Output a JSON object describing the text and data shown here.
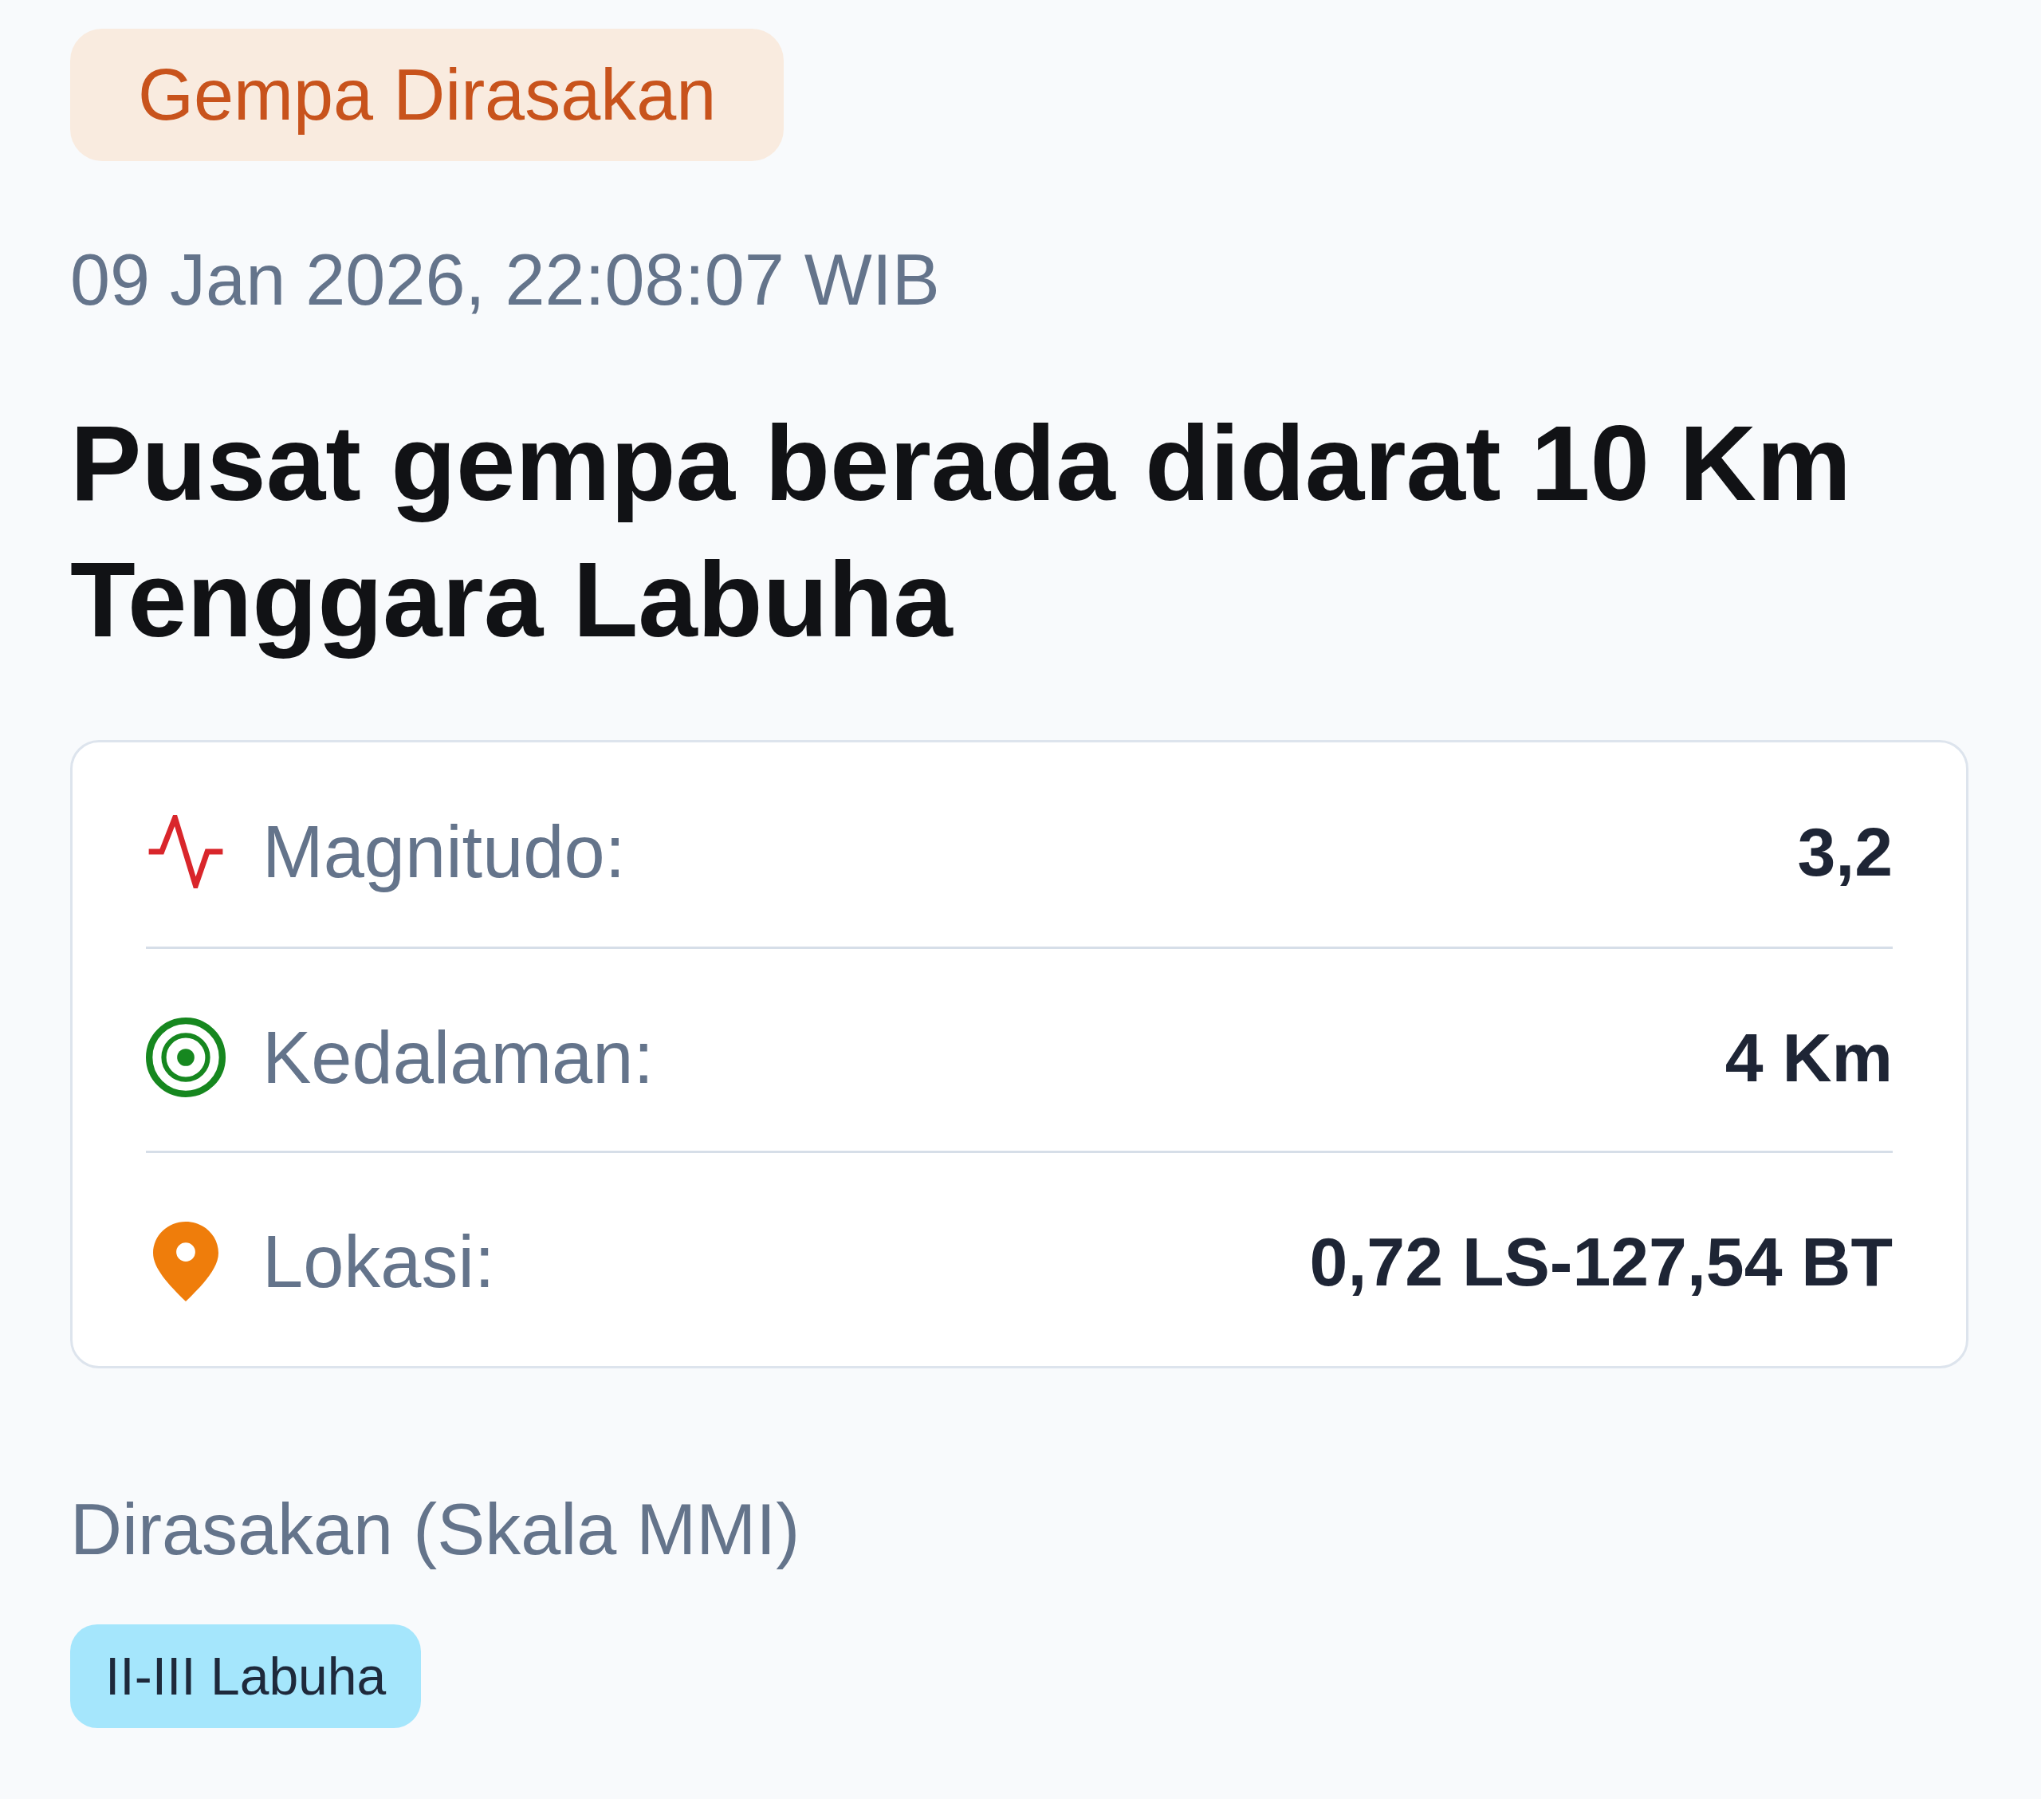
{
  "alert_badge": {
    "label": "Gempa Dirasakan"
  },
  "timestamp": "09 Jan 2026, 22:08:07 WIB",
  "headline": "Pusat gempa berada didarat 10 Km Tenggara Labuha",
  "details": [
    {
      "kind": "magnitude",
      "label": "Magnitudo:",
      "value": "3,2"
    },
    {
      "kind": "depth",
      "label": "Kedalaman:",
      "value": "4 Km"
    },
    {
      "kind": "location",
      "label": "Lokasi:",
      "value": "0,72 LS-127,54 BT"
    }
  ],
  "felt_section": {
    "heading": "Dirasakan (Skala MMI)",
    "reports": [
      {
        "label": "II-III Labuha",
        "color": "#a5e6fc"
      }
    ]
  }
}
